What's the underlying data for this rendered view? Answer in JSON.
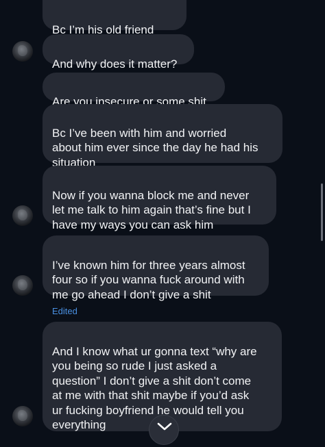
{
  "messages": [
    {
      "text": "Bc I’m his old friend"
    },
    {
      "text": "And why does it matter?"
    },
    {
      "text": "Are you insecure or some shit"
    },
    {
      "text": "Bc I’ve been with him and worried\nabout him ever since the day he had his\nsituation"
    },
    {
      "text": "Now if you wanna block me and never\nlet me talk to him again that’s fine but I\nhave my ways you can ask him"
    },
    {
      "text": "I’ve known him for three years almost\nfour so if you wanna fuck around with\nme go ahead I don’t give a shit"
    },
    {
      "text": "And I know what ur gonna text “why are\nyou being so rude I just asked a\nquestion” I don’t give a shit don’t come\nat me with that shit maybe if you’d ask\nur fucking boyfriend he would tell you\neverything"
    }
  ],
  "edited_label": "Edited",
  "colors": {
    "background": "#0a0f18",
    "bubble": "#262a34",
    "text": "#f2f3f5",
    "edited": "#4a90e2"
  },
  "icons": {
    "scroll_down": "chevron-down-icon",
    "avatar": "avatar"
  }
}
